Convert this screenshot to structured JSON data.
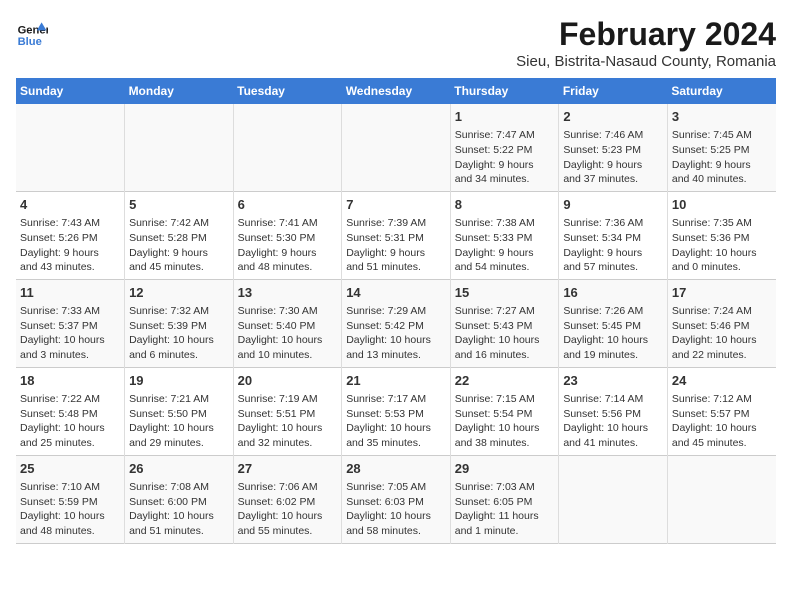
{
  "logo": {
    "text_general": "General",
    "text_blue": "Blue"
  },
  "title": "February 2024",
  "subtitle": "Sieu, Bistrita-Nasaud County, Romania",
  "days_of_week": [
    "Sunday",
    "Monday",
    "Tuesday",
    "Wednesday",
    "Thursday",
    "Friday",
    "Saturday"
  ],
  "weeks": [
    {
      "cells": [
        {
          "day": "",
          "content": ""
        },
        {
          "day": "",
          "content": ""
        },
        {
          "day": "",
          "content": ""
        },
        {
          "day": "",
          "content": ""
        },
        {
          "day": "1",
          "content": "Sunrise: 7:47 AM\nSunset: 5:22 PM\nDaylight: 9 hours\nand 34 minutes."
        },
        {
          "day": "2",
          "content": "Sunrise: 7:46 AM\nSunset: 5:23 PM\nDaylight: 9 hours\nand 37 minutes."
        },
        {
          "day": "3",
          "content": "Sunrise: 7:45 AM\nSunset: 5:25 PM\nDaylight: 9 hours\nand 40 minutes."
        }
      ]
    },
    {
      "cells": [
        {
          "day": "4",
          "content": "Sunrise: 7:43 AM\nSunset: 5:26 PM\nDaylight: 9 hours\nand 43 minutes."
        },
        {
          "day": "5",
          "content": "Sunrise: 7:42 AM\nSunset: 5:28 PM\nDaylight: 9 hours\nand 45 minutes."
        },
        {
          "day": "6",
          "content": "Sunrise: 7:41 AM\nSunset: 5:30 PM\nDaylight: 9 hours\nand 48 minutes."
        },
        {
          "day": "7",
          "content": "Sunrise: 7:39 AM\nSunset: 5:31 PM\nDaylight: 9 hours\nand 51 minutes."
        },
        {
          "day": "8",
          "content": "Sunrise: 7:38 AM\nSunset: 5:33 PM\nDaylight: 9 hours\nand 54 minutes."
        },
        {
          "day": "9",
          "content": "Sunrise: 7:36 AM\nSunset: 5:34 PM\nDaylight: 9 hours\nand 57 minutes."
        },
        {
          "day": "10",
          "content": "Sunrise: 7:35 AM\nSunset: 5:36 PM\nDaylight: 10 hours\nand 0 minutes."
        }
      ]
    },
    {
      "cells": [
        {
          "day": "11",
          "content": "Sunrise: 7:33 AM\nSunset: 5:37 PM\nDaylight: 10 hours\nand 3 minutes."
        },
        {
          "day": "12",
          "content": "Sunrise: 7:32 AM\nSunset: 5:39 PM\nDaylight: 10 hours\nand 6 minutes."
        },
        {
          "day": "13",
          "content": "Sunrise: 7:30 AM\nSunset: 5:40 PM\nDaylight: 10 hours\nand 10 minutes."
        },
        {
          "day": "14",
          "content": "Sunrise: 7:29 AM\nSunset: 5:42 PM\nDaylight: 10 hours\nand 13 minutes."
        },
        {
          "day": "15",
          "content": "Sunrise: 7:27 AM\nSunset: 5:43 PM\nDaylight: 10 hours\nand 16 minutes."
        },
        {
          "day": "16",
          "content": "Sunrise: 7:26 AM\nSunset: 5:45 PM\nDaylight: 10 hours\nand 19 minutes."
        },
        {
          "day": "17",
          "content": "Sunrise: 7:24 AM\nSunset: 5:46 PM\nDaylight: 10 hours\nand 22 minutes."
        }
      ]
    },
    {
      "cells": [
        {
          "day": "18",
          "content": "Sunrise: 7:22 AM\nSunset: 5:48 PM\nDaylight: 10 hours\nand 25 minutes."
        },
        {
          "day": "19",
          "content": "Sunrise: 7:21 AM\nSunset: 5:50 PM\nDaylight: 10 hours\nand 29 minutes."
        },
        {
          "day": "20",
          "content": "Sunrise: 7:19 AM\nSunset: 5:51 PM\nDaylight: 10 hours\nand 32 minutes."
        },
        {
          "day": "21",
          "content": "Sunrise: 7:17 AM\nSunset: 5:53 PM\nDaylight: 10 hours\nand 35 minutes."
        },
        {
          "day": "22",
          "content": "Sunrise: 7:15 AM\nSunset: 5:54 PM\nDaylight: 10 hours\nand 38 minutes."
        },
        {
          "day": "23",
          "content": "Sunrise: 7:14 AM\nSunset: 5:56 PM\nDaylight: 10 hours\nand 41 minutes."
        },
        {
          "day": "24",
          "content": "Sunrise: 7:12 AM\nSunset: 5:57 PM\nDaylight: 10 hours\nand 45 minutes."
        }
      ]
    },
    {
      "cells": [
        {
          "day": "25",
          "content": "Sunrise: 7:10 AM\nSunset: 5:59 PM\nDaylight: 10 hours\nand 48 minutes."
        },
        {
          "day": "26",
          "content": "Sunrise: 7:08 AM\nSunset: 6:00 PM\nDaylight: 10 hours\nand 51 minutes."
        },
        {
          "day": "27",
          "content": "Sunrise: 7:06 AM\nSunset: 6:02 PM\nDaylight: 10 hours\nand 55 minutes."
        },
        {
          "day": "28",
          "content": "Sunrise: 7:05 AM\nSunset: 6:03 PM\nDaylight: 10 hours\nand 58 minutes."
        },
        {
          "day": "29",
          "content": "Sunrise: 7:03 AM\nSunset: 6:05 PM\nDaylight: 11 hours\nand 1 minute."
        },
        {
          "day": "",
          "content": ""
        },
        {
          "day": "",
          "content": ""
        }
      ]
    }
  ]
}
